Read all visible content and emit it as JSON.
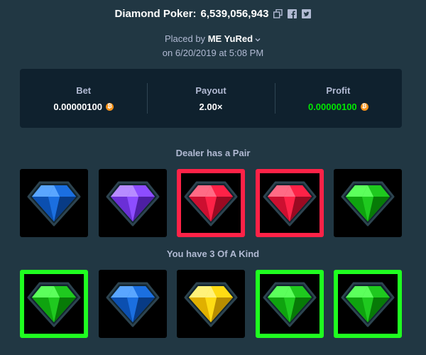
{
  "header": {
    "game": "Diamond Poker",
    "separator": ":",
    "bet_id": "6,539,056,943",
    "icons": [
      "copy-icon",
      "facebook-icon",
      "twitter-icon"
    ]
  },
  "placed": {
    "prefix": "Placed by",
    "user": "ME YuRed",
    "date_line": "on 6/20/2019 at 5:08 PM"
  },
  "stats": {
    "bet_label": "Bet",
    "bet_value": "0.00000100",
    "payout_label": "Payout",
    "payout_value": "2.00×",
    "profit_label": "Profit",
    "profit_value": "0.00000100",
    "currency_icon": "bitcoin-icon",
    "profit_color": "#00e701"
  },
  "dealer": {
    "label": "Dealer has a Pair",
    "gems": [
      {
        "color": "blue",
        "highlight": false
      },
      {
        "color": "purple",
        "highlight": false
      },
      {
        "color": "red",
        "highlight": true
      },
      {
        "color": "red",
        "highlight": true
      },
      {
        "color": "green",
        "highlight": false
      }
    ],
    "highlight_color": "#fe2247"
  },
  "player": {
    "label": "You have 3 Of A Kind",
    "gems": [
      {
        "color": "green",
        "highlight": true
      },
      {
        "color": "blue",
        "highlight": false
      },
      {
        "color": "yellow",
        "highlight": false
      },
      {
        "color": "green",
        "highlight": true
      },
      {
        "color": "green",
        "highlight": true
      }
    ],
    "highlight_color": "#1fff20"
  },
  "palette": {
    "background": "#213743",
    "panel": "#0f212e",
    "muted_text": "#b1bad3",
    "gem_blue": "#1b6fe0",
    "gem_purple": "#8d4dff",
    "gem_red": "#fe2247",
    "gem_green": "#1fc91f",
    "gem_yellow": "#fedb14"
  }
}
